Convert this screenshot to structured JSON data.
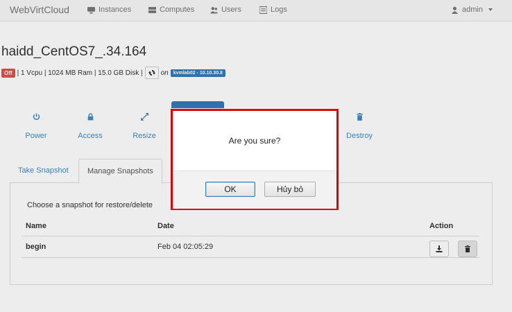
{
  "navbar": {
    "brand": "WebVirtCloud",
    "items": [
      {
        "label": "Instances",
        "icon": "monitor-icon"
      },
      {
        "label": "Computes",
        "icon": "server-icon"
      },
      {
        "label": "Users",
        "icon": "users-icon"
      },
      {
        "label": "Logs",
        "icon": "list-icon"
      }
    ],
    "user": "admin"
  },
  "instance": {
    "name": "haidd_CentOS7_.34.164",
    "status": "Off",
    "specs": "| 1 Vcpu | 1024 MB Ram | 15.0 GB Disk |",
    "on": "on",
    "host": "kvmlab02 - 10.10.30.8"
  },
  "actions": [
    "Power",
    "Access",
    "Resize",
    "Destroy"
  ],
  "tabs": [
    "Take Snapshot",
    "Manage Snapshots"
  ],
  "snapshots": {
    "hint": "Choose a snapshot for restore/delete",
    "headers": {
      "name": "Name",
      "date": "Date",
      "action": "Action"
    },
    "rows": [
      {
        "name": "begin",
        "date": "Feb 04 02:05:29"
      }
    ]
  },
  "dialog": {
    "message": "Are you sure?",
    "ok": "OK",
    "cancel": "Hủy bỏ"
  },
  "colors": {
    "accent": "#428bca",
    "danger": "#d9534f",
    "highlight": "#e00000"
  }
}
